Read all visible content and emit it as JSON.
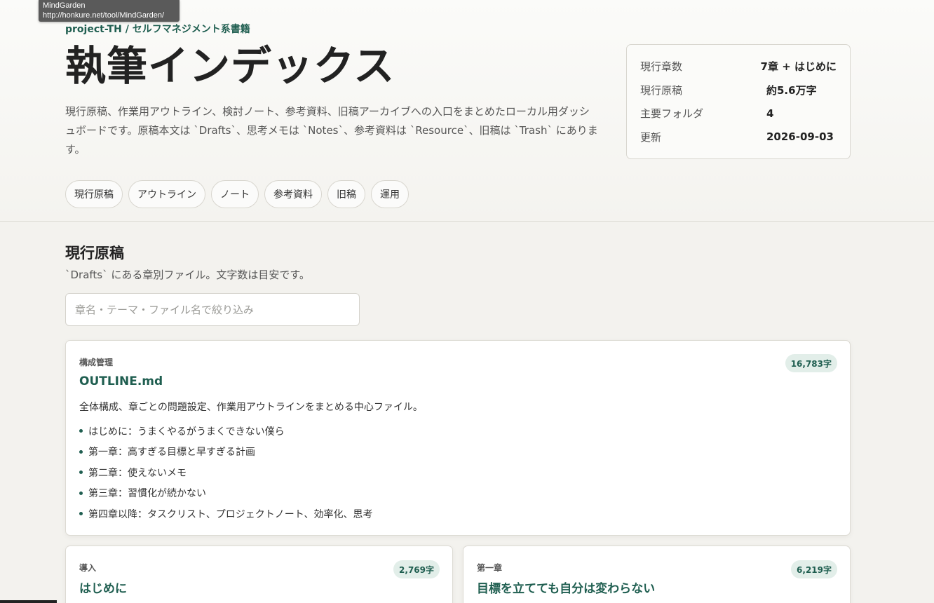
{
  "tooltip": {
    "title": "MindGarden",
    "url": "http://honkure.net/tool/MindGarden/"
  },
  "header": {
    "eyebrow": "project-TH / セルフマネジメント系書籍",
    "title": "執筆インデックス",
    "lead": "現行原稿、作業用アウトライン、検討ノート、参考資料、旧稿アーカイブへの入口をまとめたローカル用ダッシュボードです。原稿本文は `Drafts`、思考メモは `Notes`、参考資料は `Resource`、旧稿は `Trash` にあります。",
    "tags": [
      "現行原稿",
      "アウトライン",
      "ノート",
      "参考資料",
      "旧稿",
      "運用"
    ]
  },
  "stats": [
    {
      "label": "現行章数",
      "value": "7章 + はじめに"
    },
    {
      "label": "現行原稿",
      "value": "約5.6万字"
    },
    {
      "label": "主要フォルダ",
      "value": "4"
    },
    {
      "label": "更新",
      "value": "2026-09-03"
    }
  ],
  "section": {
    "title": "現行原稿",
    "description": "`Drafts` にある章別ファイル。文字数は目安です。",
    "filter_placeholder": "章名・テーマ・ファイル名で絞り込み"
  },
  "cards": {
    "outline": {
      "kicker": "構成管理",
      "title": "OUTLINE.md",
      "count": "16,783字",
      "description": "全体構成、章ごとの問題設定、作業用アウトラインをまとめる中心ファイル。",
      "items": [
        "はじめに：うまくやるがうまくできない僕ら",
        "第一章：高すぎる目標と早すぎる計画",
        "第二章：使えないメモ",
        "第三章：習慣化が続かない",
        "第四章以降：タスクリスト、プロジェクトノート、効率化、思考"
      ]
    },
    "intro": {
      "kicker": "導入",
      "title": "はじめに",
      "count": "2,769字"
    },
    "chapter1": {
      "kicker": "第一章",
      "title": "目標を立てても自分は変わらない",
      "count": "6,219字"
    }
  }
}
